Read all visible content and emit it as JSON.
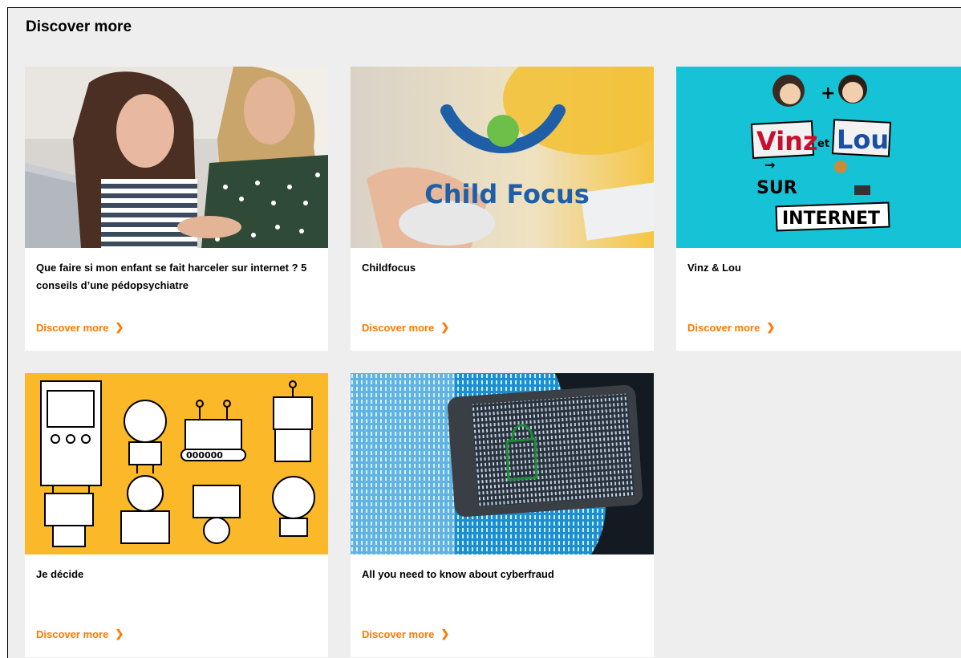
{
  "section": {
    "title": "Discover more"
  },
  "cards": [
    {
      "title": "Que faire si mon enfant se fait harceler sur internet ? 5 conseils d’une pédopsychiatre",
      "link": "Discover more",
      "image": "mother-daughter-laptop-photo"
    },
    {
      "title": "Childfocus",
      "link": "Discover more",
      "image": "child-focus-logo",
      "image_text": "Child Focus"
    },
    {
      "title": "Vinz & Lou",
      "link": "Discover more",
      "image": "vinz-et-lou-illustration",
      "image_text": {
        "line1": "Vinz",
        "line1b": "et",
        "line1c": "Lou",
        "line2": "SUR",
        "line3": "INTERNET"
      }
    },
    {
      "title": "Je décide",
      "link": "Discover more",
      "image": "robots-illustration",
      "robot_counter": "000000"
    },
    {
      "title": "All you need to know about cyberfraud",
      "link": "Discover more",
      "image": "smartphone-binary-lock-photo"
    }
  ],
  "colors": {
    "accent": "#ff7900",
    "background": "#eeeeee",
    "card": "#ffffff",
    "robots_bg": "#fbb829",
    "vinz_bg": "#16c3d6"
  },
  "icons": {
    "link_chevron": "chevron-right-icon"
  }
}
